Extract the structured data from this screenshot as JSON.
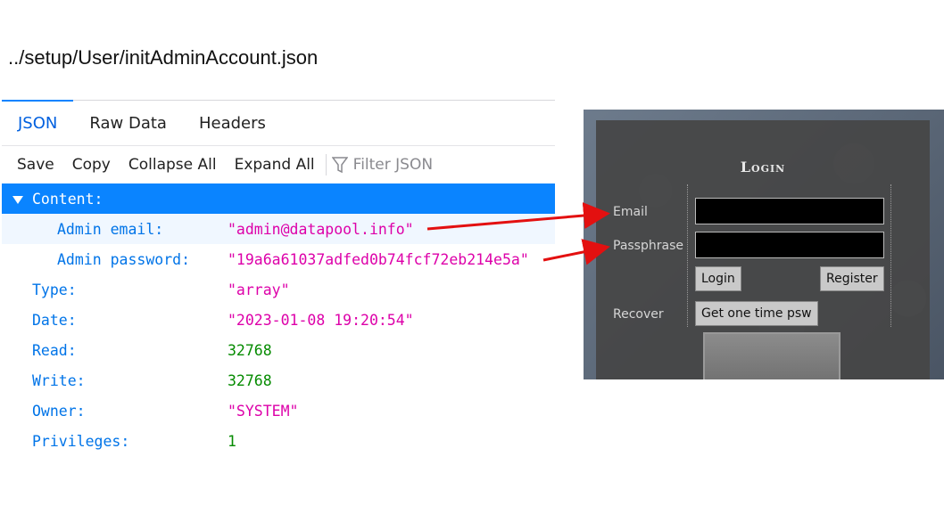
{
  "caption": "../setup/User/initAdminAccount.json",
  "tabs": [
    {
      "label": "JSON"
    },
    {
      "label": "Raw Data"
    },
    {
      "label": "Headers"
    }
  ],
  "toolbar": {
    "save": "Save",
    "copy": "Copy",
    "collapse_all": "Collapse All",
    "expand_all": "Expand All",
    "filter_placeholder": "Filter JSON"
  },
  "json": {
    "content_key": "Content:",
    "admin_email_key": "Admin email:",
    "admin_email_val": "\"admin@datapool.info\"",
    "admin_password_key": "Admin password:",
    "admin_password_val": "\"19a6a61037adfed0b74fcf72eb214e5a\"",
    "type_key": "Type:",
    "type_val": "\"array\"",
    "date_key": "Date:",
    "date_val": "\"2023-01-08 19:20:54\"",
    "read_key": "Read:",
    "read_val": "32768",
    "write_key": "Write:",
    "write_val": "32768",
    "owner_key": "Owner:",
    "owner_val": "\"SYSTEM\"",
    "privileges_key": "Privileges:",
    "privileges_val": "1"
  },
  "login": {
    "title": "Login",
    "email_label": "Email",
    "passphrase_label": "Passphrase",
    "login_button": "Login",
    "register_button": "Register",
    "recover_label": "Recover",
    "otp_button": "Get one time psw"
  },
  "colors": {
    "accent": "#0a84ff",
    "string": "#dd00a9",
    "number": "#058b00",
    "key": "#0074e8",
    "arrow": "#e31010"
  }
}
